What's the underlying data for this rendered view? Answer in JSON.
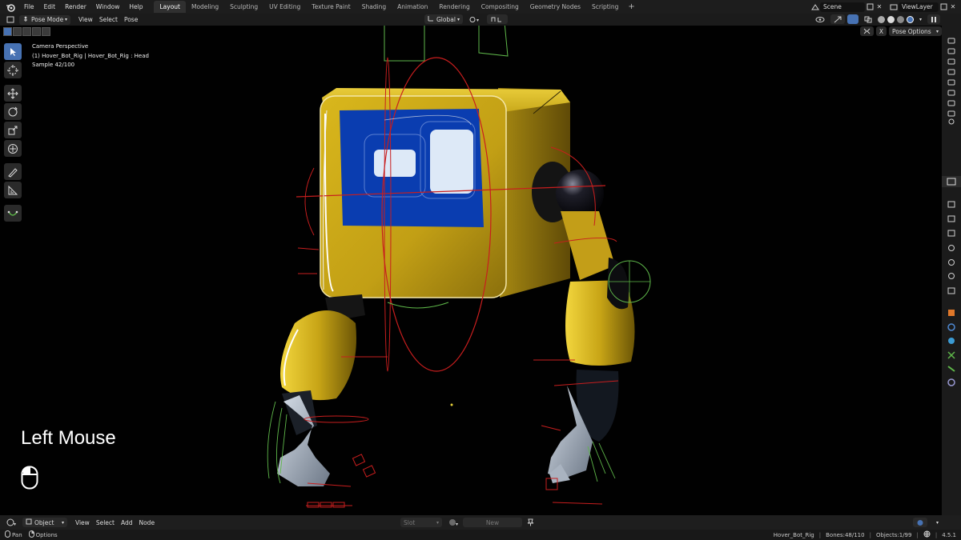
{
  "topbar": {
    "menus": [
      "File",
      "Edit",
      "Render",
      "Window",
      "Help"
    ],
    "workspaces": [
      "Layout",
      "Modeling",
      "Sculpting",
      "UV Editing",
      "Texture Paint",
      "Shading",
      "Animation",
      "Rendering",
      "Compositing",
      "Geometry Nodes",
      "Scripting"
    ],
    "active_workspace": "Layout",
    "add_tab": "+",
    "scene": "Scene",
    "view_layer": "ViewLayer"
  },
  "viewport_header": {
    "mode": "Pose Mode",
    "menus": [
      "View",
      "Select",
      "Pose"
    ],
    "orientation": "Global",
    "pose_options": "Pose Options",
    "x_mirror": "X"
  },
  "viewport_info": {
    "line1": "Camera Perspective",
    "line2": "(1) Hover_Bot_Rig | Hover_Bot_Rig : Head",
    "line3": "Sample 42/100"
  },
  "mouse_overlay": {
    "label": "Left Mouse"
  },
  "bottom_bar": {
    "editor": "Object",
    "menus": [
      "View",
      "Select",
      "Add",
      "Node"
    ],
    "slot": "Slot",
    "new_button": "New"
  },
  "status_bar": {
    "pan": "Pan",
    "options": "Options",
    "object": "Hover_Bot_Rig",
    "bones": "Bones:48/110",
    "objects": "Objects:1/99",
    "version": "4.5.1"
  },
  "colors": {
    "accent": "#4772b3",
    "body_yellow": "#d4b21a",
    "screen_blue": "#0a3db0",
    "bone_red": "#c81e1e",
    "bone_green": "#5fb84a"
  }
}
